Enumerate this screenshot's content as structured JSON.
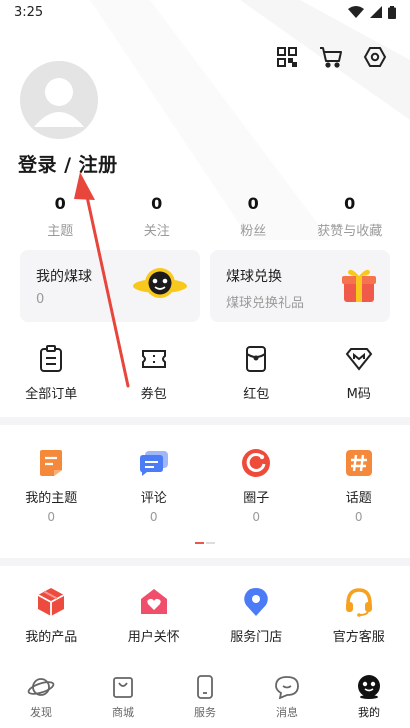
{
  "status": {
    "time": "3:25"
  },
  "profile": {
    "login_label": "登录 / 注册"
  },
  "stats": [
    {
      "value": "0",
      "label": "主题"
    },
    {
      "value": "0",
      "label": "关注"
    },
    {
      "value": "0",
      "label": "粉丝"
    },
    {
      "value": "0",
      "label": "获赞与收藏"
    }
  ],
  "cards": {
    "coal": {
      "title": "我的煤球",
      "value": "0"
    },
    "exchange": {
      "title": "煤球兑换",
      "subtitle": "煤球兑换礼品"
    }
  },
  "orders": [
    {
      "label": "全部订单",
      "icon": "clipboard-icon"
    },
    {
      "label": "券包",
      "icon": "ticket-icon"
    },
    {
      "label": "红包",
      "icon": "red-packet-icon"
    },
    {
      "label": "M码",
      "icon": "m-code-icon"
    }
  ],
  "community": [
    {
      "label": "我的主题",
      "count": "0",
      "color": "#f5893b"
    },
    {
      "label": "评论",
      "count": "0",
      "color": "#4b7cf5"
    },
    {
      "label": "圈子",
      "count": "0",
      "color": "#ef4b3a"
    },
    {
      "label": "话题",
      "count": "0",
      "color": "#f5893b"
    }
  ],
  "services": [
    {
      "label": "我的产品",
      "color": "#ee4b3f"
    },
    {
      "label": "用户关怀",
      "color": "#ef4f6a"
    },
    {
      "label": "服务门店",
      "color": "#4b7cf5"
    },
    {
      "label": "官方客服",
      "color": "#f6a11f"
    }
  ],
  "nav": [
    {
      "label": "发现",
      "icon": "planet-icon"
    },
    {
      "label": "商城",
      "icon": "shopping-bag-icon"
    },
    {
      "label": "服务",
      "icon": "phone-icon"
    },
    {
      "label": "消息",
      "icon": "chat-icon"
    },
    {
      "label": "我的",
      "icon": "mascot-icon",
      "active": true
    }
  ]
}
